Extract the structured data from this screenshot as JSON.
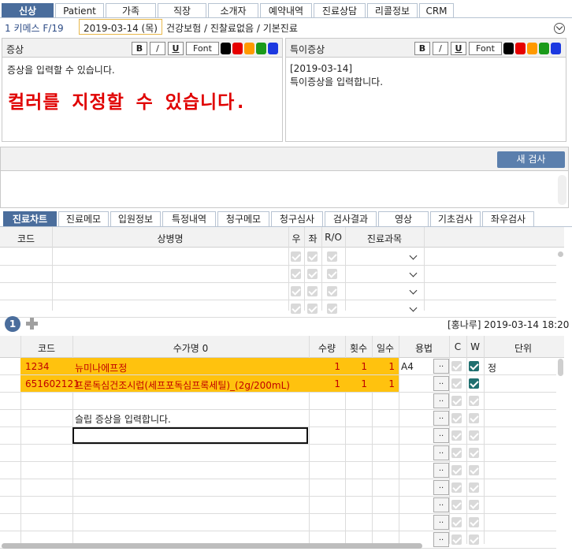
{
  "top_tabs": [
    "신상",
    "Patient",
    "가족",
    "직장",
    "소개자",
    "예약내역",
    "진료상담",
    "리콜정보",
    "CRM"
  ],
  "visit_bar": {
    "info": "1 키메스 F/19",
    "date": "2019-03-14 (목)",
    "desc": "건강보험 / 진찰료없음 / 기본진료"
  },
  "symptom": {
    "title": "증상",
    "placeholder": "증상을 입력할 수 있습니다.",
    "color_text": "컬러를 지정할 수 있습니다."
  },
  "special": {
    "title": "특이증상",
    "date": "[2019-03-14]",
    "text": "특이증상을 입력합니다."
  },
  "format": {
    "bold": "B",
    "italic": "/",
    "underline": "U",
    "font": "Font"
  },
  "colors": {
    "black": "#000000",
    "red": "#e60000",
    "orange": "#ff9900",
    "yellow": "#f2c200",
    "green": "#1a9a1a",
    "blue": "#1c39e0",
    "accent": "#4a6d9c",
    "highlight": "#ffc20e",
    "emphasis": "#e00000"
  },
  "new_exam_label": "새 검사",
  "sub_tabs": [
    "진료차트",
    "진료메모",
    "입원정보",
    "특정내역",
    "청구메모",
    "청구심사",
    "검사결과",
    "영상",
    "기초검사",
    "좌우검사"
  ],
  "diag_headers": {
    "code": "코드",
    "name": "상병명",
    "u": "우",
    "jwa": "좌",
    "ro": "R/O",
    "dept": "진료과목"
  },
  "info_line": {
    "badge": "1",
    "user": "[홍나루] 2019-03-14 18:20"
  },
  "rx_headers": {
    "code": "코드",
    "name": "수가명 0",
    "qty": "수량",
    "times": "횟수",
    "days": "일수",
    "usage": "용법",
    "c": "C",
    "w": "W",
    "unit": "단위"
  },
  "rx_rows": [
    {
      "code": "1234",
      "name": "뉴미나에프정",
      "qty": "1",
      "times": "1",
      "days": "1",
      "usage": "A4",
      "unit": "정"
    },
    {
      "code": "651602121",
      "name": "프론독심건조시럽(세프포독심프록세틸)_(2g/200mL)",
      "qty": "1",
      "times": "1",
      "days": "1",
      "usage": "",
      "unit": ""
    }
  ],
  "slip_text": "슬립 증상을 입력합니다."
}
